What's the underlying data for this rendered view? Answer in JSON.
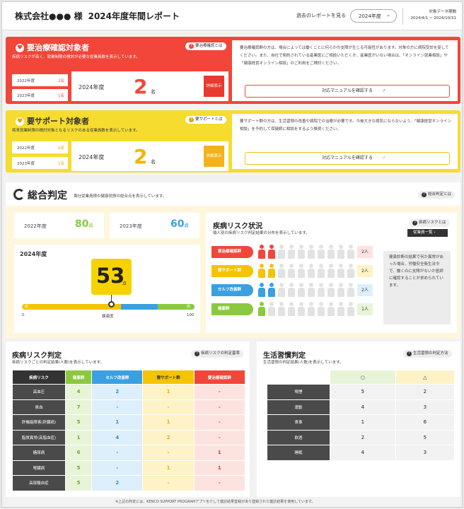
{
  "header": {
    "company": "株式会社●●● 様",
    "report_title": "2024年度年間レポート",
    "past_report_label": "過去のレポートを見る",
    "year_select": "2024年度",
    "period_label": "対象データ期間",
    "period_value": "2024/4/1 ~ 2024/10/31"
  },
  "treatment": {
    "title": "要治療確認対象者",
    "desc": "疾病リスクが高く、就業制限の検討が必要な従業員数を表示しています。",
    "help": "要治療確認とは",
    "prev": [
      {
        "year": "2022年度",
        "count": "2名"
      },
      {
        "year": "2023年度",
        "count": "1名"
      }
    ],
    "current_year": "2024年度",
    "current_count": "2",
    "unit": "名",
    "detail_button": "詳細表示",
    "notice": "要治療確認群の方は、場合によっては働くことに何らかの支障が生じる可能性があります。対象の方に病院受診を促してください。また、自社で契約されている産業医にご相談いただくか、産業医がいない場合は、「オンライン就業相談」や「健康経営オンライン相談」のご利用をご検討ください。",
    "manual_button": "対応マニュアルを確認する"
  },
  "support": {
    "title": "要サポート対象者",
    "desc": "将来就業制限の検討対象となるリスクのある従業員数を表示しています。",
    "help": "要サポートとは",
    "prev": [
      {
        "year": "2022年度",
        "count": "0名"
      },
      {
        "year": "2023年度",
        "count": "1名"
      }
    ],
    "current_year": "2024年度",
    "current_count": "2",
    "unit": "名",
    "detail_button": "詳細表示",
    "notice": "要サポート群の方は、生活習慣の改善や病院での治療が必要です。今後大きな病気にならないよう、「健康経営オンライン相談」を予約して保健師に相談をするよう推奨ください。",
    "manual_button": "対応マニュアルを確認する"
  },
  "overall": {
    "title": "総合判定",
    "desc": "貴社従業員様の健康状態の総合点を表示しています。",
    "help": "総合判定とは",
    "y2022_label": "2022年度",
    "y2022_value": "80",
    "y2023_label": "2023年度",
    "y2023_value": "60",
    "unit": "点",
    "current_label": "2024年度",
    "current_score": "53",
    "score_value": 53,
    "bar_low": "低",
    "bar_high": "高",
    "axis_min": "0",
    "axis_mid": "健康度",
    "axis_max": "100"
  },
  "risk_status": {
    "title": "疾病リスク状況",
    "desc": "個人別の疾病リスク判定結果の分布を表示しています。",
    "help": "疾病リスクとは",
    "list_button": "従業員一覧",
    "total_icons": 10,
    "rows": [
      {
        "label": "要治療確認群",
        "count_label": "2人",
        "count": 2,
        "color": "#f2463a",
        "bg": "#fde3df"
      },
      {
        "label": "要サポート群",
        "count_label": "2人",
        "count": 2,
        "color": "#f5c400",
        "bg": "#fdf3c7"
      },
      {
        "label": "セルフ改善群",
        "count_label": "2人",
        "count": 2,
        "color": "#3aa0e0",
        "bg": "#dceffb"
      },
      {
        "label": "健康群",
        "count_label": "1人",
        "count": 1,
        "color": "#8ac93f",
        "bg": "#e8f4d8"
      }
    ],
    "note": "健康診断の結果で何か異常があった場合、労働安全衛生法令で、働くのに支障がないか医師に確認することが求められています。"
  },
  "disease_risk": {
    "title": "疾病リスク判定",
    "desc": "疾病リスクごとの判定結果(人数)を表示しています。",
    "help": "疾病リスクの判定基準",
    "headers": [
      "疾病リスク",
      "健康群",
      "セルフ改善群",
      "要サポート群",
      "要治療確認群"
    ],
    "rows": [
      {
        "name": "高血圧",
        "cells": [
          "4",
          "2",
          "1",
          "-"
        ]
      },
      {
        "name": "貧血",
        "cells": [
          "7",
          "-",
          "-",
          "-"
        ]
      },
      {
        "name": "肝機能障害(肝臓病)",
        "cells": [
          "5",
          "1",
          "1",
          "-"
        ]
      },
      {
        "name": "脂質異常(高脂血症)",
        "cells": [
          "1",
          "4",
          "2",
          "-"
        ]
      },
      {
        "name": "糖尿病",
        "cells": [
          "6",
          "-",
          "-",
          "1"
        ]
      },
      {
        "name": "腎臓病",
        "cells": [
          "5",
          "-",
          "1",
          "1"
        ]
      },
      {
        "name": "高尿酸血症",
        "cells": [
          "5",
          "2",
          "-",
          "-"
        ]
      }
    ]
  },
  "lifestyle": {
    "title": "生活習慣判定",
    "desc": "生活習慣の判定結果(人数)を表示しています。",
    "help": "生活習慣の判定方法",
    "headers": [
      "",
      "○",
      "△"
    ],
    "rows": [
      {
        "name": "喫煙",
        "cells": [
          "5",
          "2"
        ]
      },
      {
        "name": "運動",
        "cells": [
          "4",
          "3"
        ]
      },
      {
        "name": "食事",
        "cells": [
          "1",
          "6"
        ]
      },
      {
        "name": "飲酒",
        "cells": [
          "2",
          "5"
        ]
      },
      {
        "name": "睡眠",
        "cells": [
          "4",
          "3"
        ]
      }
    ]
  },
  "footnote": "※上記の判定には、KENCO SUPPORT PROGRAMアプリを介して健診結果登録があり登録された健診結果を使用しています。"
}
